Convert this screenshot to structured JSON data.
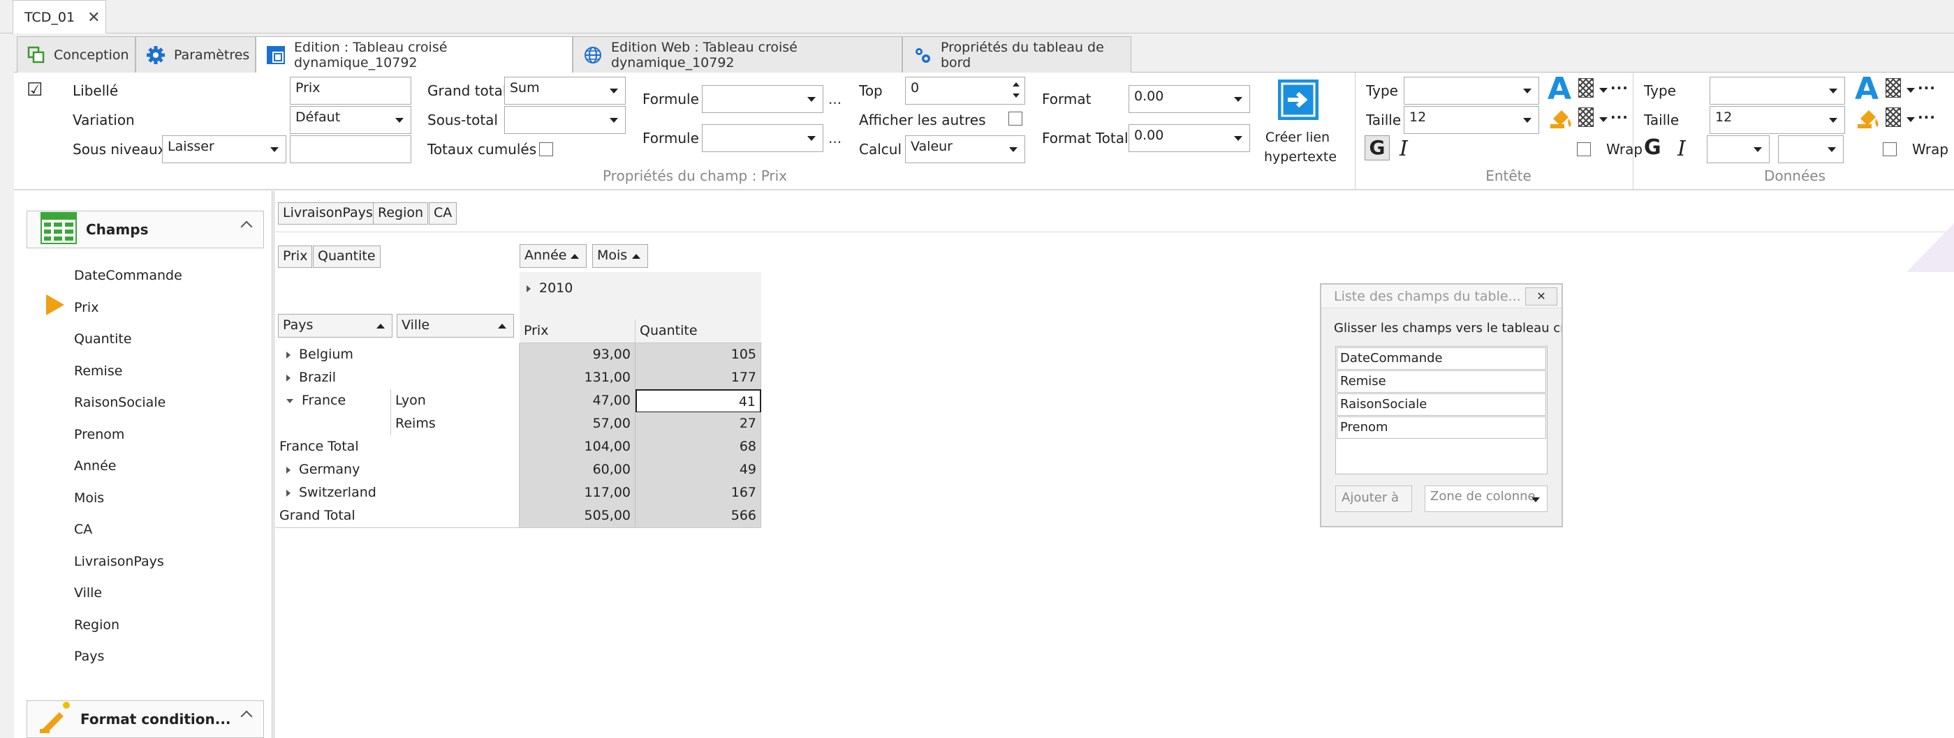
{
  "doc_tab": {
    "title": "TCD_01",
    "close": "✕"
  },
  "tabs": [
    {
      "label": "Conception"
    },
    {
      "label": "Paramètres"
    },
    {
      "label": "Edition : Tableau croisé dynamique_10792"
    },
    {
      "label": "Edition Web : Tableau croisé dynamique_10792"
    },
    {
      "label": "Propriétés du tableau de bord"
    }
  ],
  "ribbon": {
    "field": {
      "libelle_label": "Libellé",
      "libelle_value": "Prix",
      "variation_label": "Variation",
      "variation_value": "Défaut",
      "sous_niveaux_label": "Sous niveaux",
      "sous_niveaux_value": "Laisser",
      "sous_niveaux_text": "",
      "grand_total_label": "Grand total",
      "grand_total_value": "Sum",
      "sous_total_label": "Sous-total",
      "sous_total_value": "",
      "totaux_cumules_label": "Totaux cumulés",
      "formule1_label": "Formule",
      "formule1_value": "",
      "formule2_label": "Formule",
      "formule2_value": "",
      "ellipsis": "...",
      "top_label": "Top",
      "top_value": "0",
      "afficher_autres_label": "Afficher les autres",
      "calcul_label": "Calcul",
      "calcul_value": "Valeur",
      "format_label": "Format",
      "format_value": "0.00",
      "format_total_label": "Format Total",
      "format_total_value": "0.00",
      "hyperlink_label_1": "Créer lien",
      "hyperlink_label_2": "hypertexte",
      "group_label": "Propriétés du champ : Prix"
    },
    "entete": {
      "type_label": "Type",
      "type_value": "",
      "taille_label": "Taille",
      "taille_value": "12",
      "bold": "G",
      "italic": "I",
      "wrap_label": "Wrap",
      "font_color_glyph": "A",
      "more": "···",
      "group_label": "Entête"
    },
    "donnees": {
      "type_label": "Type",
      "type_value": "",
      "taille_label": "Taille",
      "taille_value": "12",
      "bold": "G",
      "italic": "I",
      "wrap_label": "Wrap",
      "font_color_glyph": "A",
      "more": "···",
      "extra1_value": "",
      "extra2_value": "",
      "group_label": "Données"
    }
  },
  "left_panel": {
    "fields_title": "Champs",
    "fields": [
      "DateCommande",
      "Prix",
      "Quantite",
      "Remise",
      "RaisonSociale",
      "Prenom",
      "Année",
      "Mois",
      "CA",
      "LivraisonPays",
      "Ville",
      "Region",
      "Pays"
    ],
    "format_title": "Format condition..."
  },
  "pivot": {
    "filter_fields": [
      "LivraisonPays",
      "Region",
      "CA"
    ],
    "data_fields": [
      "Prix",
      "Quantite"
    ],
    "column_fields": [
      "Année",
      "Mois"
    ],
    "row_fields": [
      "Pays",
      "Ville"
    ],
    "year": "2010",
    "measure_headers": [
      "Prix",
      "Quantite"
    ],
    "rows": [
      {
        "pays": "Belgium",
        "ville": "",
        "prix": "93,00",
        "quantite": "105"
      },
      {
        "pays": "Brazil",
        "ville": "",
        "prix": "131,00",
        "quantite": "177"
      },
      {
        "pays": "France",
        "ville": "Lyon",
        "prix": "47,00",
        "quantite": "41"
      },
      {
        "pays": "",
        "ville": "Reims",
        "prix": "57,00",
        "quantite": "27"
      },
      {
        "pays": "France Total",
        "ville": "",
        "prix": "104,00",
        "quantite": "68"
      },
      {
        "pays": "Germany",
        "ville": "",
        "prix": "60,00",
        "quantite": "49"
      },
      {
        "pays": "Switzerland",
        "ville": "",
        "prix": "117,00",
        "quantite": "167"
      },
      {
        "pays": "Grand Total",
        "ville": "",
        "prix": "505,00",
        "quantite": "566"
      }
    ]
  },
  "field_list": {
    "title": "Liste des champs du table...",
    "close": "✕",
    "hint": "Glisser les champs vers le tableau crois",
    "items": [
      "DateCommande",
      "Remise",
      "RaisonSociale",
      "Prenom"
    ],
    "add_button": "Ajouter à",
    "zone_value": "Zone de colonne"
  }
}
